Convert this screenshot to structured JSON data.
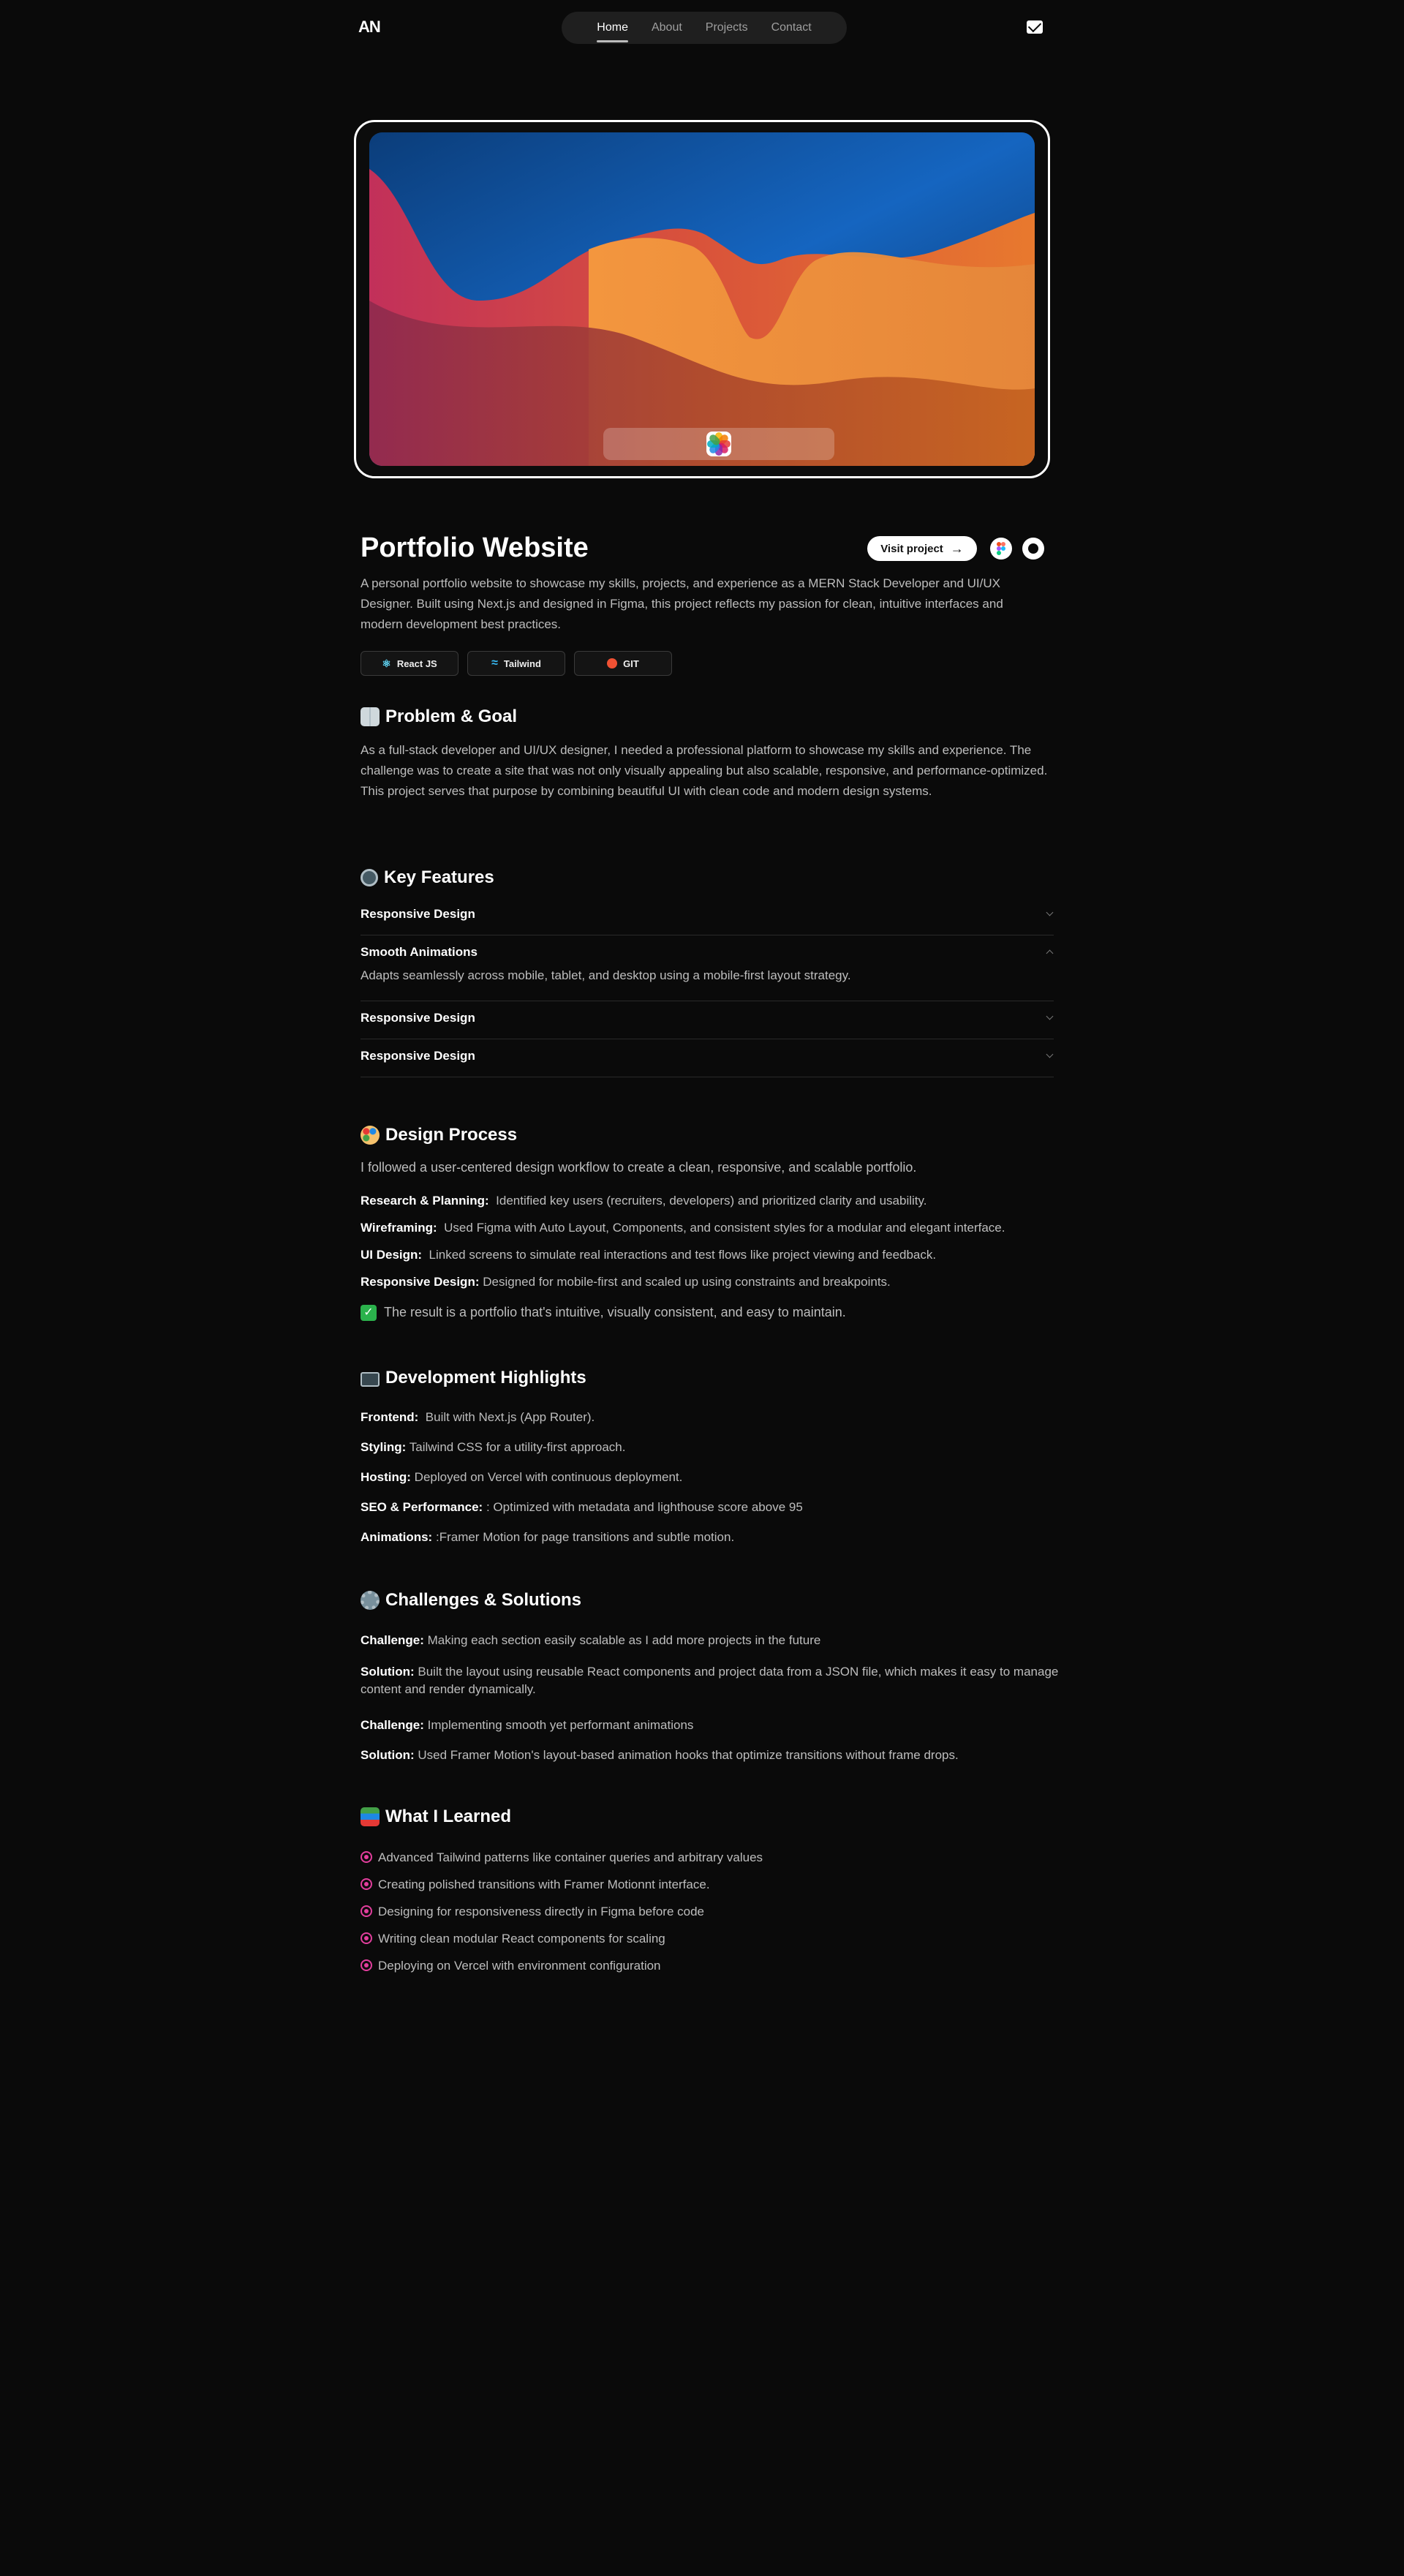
{
  "header": {
    "logo": "AN",
    "nav": [
      "Home",
      "About",
      "Projects",
      "Contact"
    ],
    "active": "Home"
  },
  "project": {
    "title": "Portfolio Website",
    "visit_label": "Visit project",
    "description": "A personal portfolio website to showcase my skills, projects, and experience as a MERN Stack Developer and UI/UX Designer. Built using Next.js and designed in Figma, this project reflects my passion for clean, intuitive interfaces and modern development best practices.",
    "tags": [
      "React JS",
      "Tailwind",
      "GIT"
    ]
  },
  "problem": {
    "heading": "Problem & Goal",
    "text": "As a full-stack developer and UI/UX designer, I needed a professional platform to showcase my skills and experience. The challenge was to create a site that was not only visually appealing but also scalable, responsive, and performance-optimized. This project serves that purpose by combining beautiful UI with clean code and modern design systems."
  },
  "features": {
    "heading": "Key Features",
    "items": [
      {
        "title": "Responsive Design"
      },
      {
        "title": "Smooth Animations",
        "body": "Adapts seamlessly across mobile, tablet, and desktop using a mobile-first layout strategy."
      },
      {
        "title": "Responsive Design"
      },
      {
        "title": "Responsive Design"
      }
    ]
  },
  "design": {
    "heading": "Design Process",
    "intro": "I followed a user-centered design workflow to create a clean, responsive, and scalable portfolio.",
    "steps": [
      {
        "label": "Research & Planning:",
        "text": "Identified key users (recruiters, developers) and prioritized clarity and usability."
      },
      {
        "label": "Wireframing:",
        "text": "Used Figma with Auto Layout, Components, and consistent styles for a modular and elegant interface."
      },
      {
        "label": "UI Design:",
        "text": "Linked screens to simulate real interactions and test flows like project viewing and feedback."
      },
      {
        "label": "Responsive Design:",
        "text": "Designed for mobile-first and scaled up using constraints and breakpoints."
      }
    ],
    "result": "The result is a portfolio that's intuitive, visually consistent, and easy to maintain."
  },
  "dev": {
    "heading": "Development Highlights",
    "items": [
      {
        "label": "Frontend:",
        "text": "Built with Next.js (App Router)."
      },
      {
        "label": "Styling:",
        "text": "Tailwind CSS for a utility-first approach."
      },
      {
        "label": "Hosting:",
        "text": "Deployed on Vercel with continuous deployment."
      },
      {
        "label": "SEO & Performance:",
        "text": ": Optimized with metadata and lighthouse score above 95"
      },
      {
        "label": "Animations:",
        "text": ":Framer Motion for page transitions and subtle motion."
      }
    ]
  },
  "challenges": {
    "heading": "Challenges & Solutions",
    "items": [
      {
        "label": "Challenge:",
        "text": "Making each section easily scalable as I add more projects in the future"
      },
      {
        "label": "Solution:",
        "text": "Built the layout using reusable React components and project data from a JSON file, which makes it easy to manage content and render dynamically."
      },
      {
        "label": "Challenge:",
        "text": "Implementing smooth yet performant animations"
      },
      {
        "label": "Solution:",
        "text": "Used Framer Motion's layout-based animation hooks that optimize transitions without frame drops."
      }
    ]
  },
  "learned": {
    "heading": "What I Learned",
    "items": [
      "Advanced Tailwind patterns like container queries and arbitrary values",
      "Creating polished transitions with Framer Motionnt interface.",
      "Designing for responsiveness directly in Figma before code",
      "Writing clean modular React components for scaling",
      "Deploying on Vercel with environment configuration"
    ]
  },
  "colors": {
    "background": "#0a0a0a",
    "accent_bullet": "#e23e9d"
  }
}
